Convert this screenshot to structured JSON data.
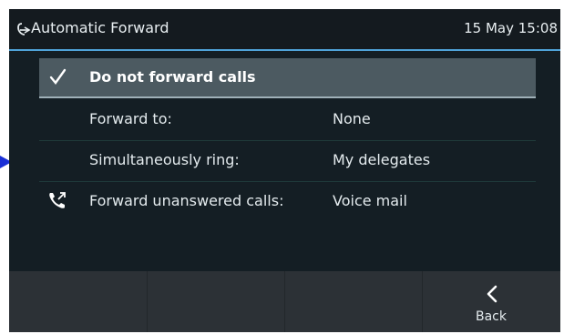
{
  "header": {
    "icon": "call-forward-icon",
    "title": "Automatic Forward",
    "datetime": "15 May 15:08"
  },
  "menu": {
    "items": [
      {
        "icon": "checkmark-icon",
        "label": "Do not forward calls",
        "value": "",
        "selected": true
      },
      {
        "icon": "",
        "label": "Forward to:",
        "value": "None",
        "selected": false
      },
      {
        "icon": "",
        "label": "Simultaneously ring:",
        "value": "My delegates",
        "selected": false
      },
      {
        "icon": "forwarded-call-icon",
        "label": "Forward unanswered calls:",
        "value": "Voice mail",
        "selected": false
      }
    ]
  },
  "softkeys": [
    {
      "label": ""
    },
    {
      "label": ""
    },
    {
      "label": ""
    },
    {
      "icon": "chevron-left-icon",
      "label": "Back"
    }
  ],
  "colors": {
    "screen_bg": "#141e24",
    "header_accent": "#4fa3d9",
    "selected_row": "#4c5a61",
    "softkey_bar": "#2c3136",
    "pointer": "#1a2fd6"
  }
}
